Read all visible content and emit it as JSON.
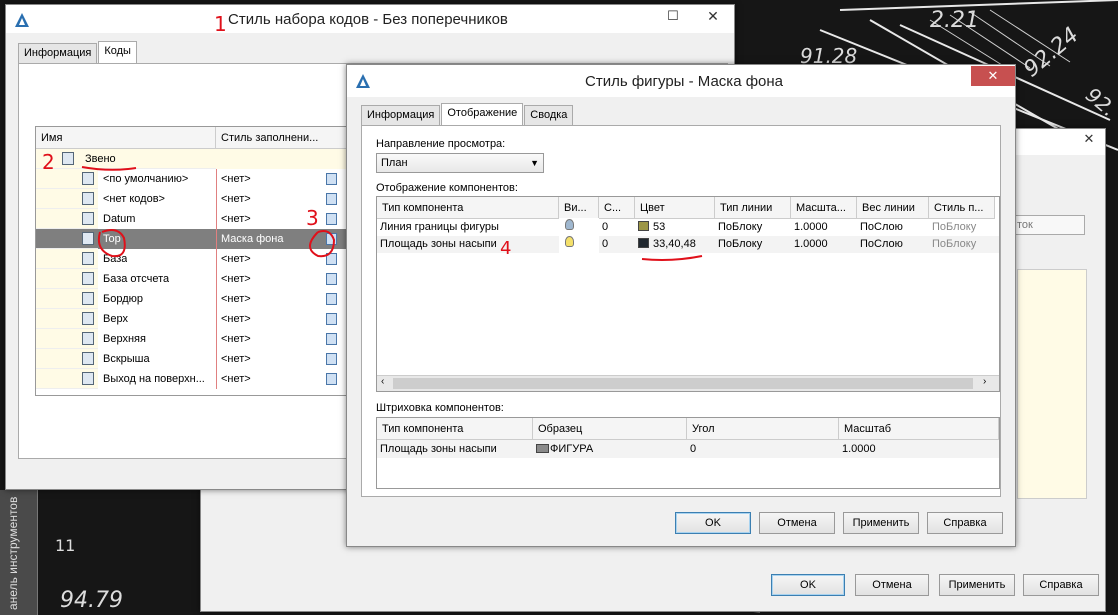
{
  "cad": {
    "labels": [
      "2.21",
      "91.28",
      "92.24",
      "92.",
      "94.79",
      "11"
    ],
    "toolstrip_label": "анель инструментов"
  },
  "backdialog": {
    "partial_text": "ток",
    "buttons": {
      "ok": "OK",
      "cancel": "Отмена",
      "apply": "Применить",
      "help": "Справка"
    }
  },
  "codeset": {
    "title": "Стиль набора кодов - Без поперечников",
    "tabs": [
      "Информация",
      "Коды"
    ],
    "columns": [
      "Имя",
      "Стиль заполнени..."
    ],
    "root": {
      "name": "Звено"
    },
    "rows": [
      {
        "name": "<по умолчанию>",
        "style": "<нет>"
      },
      {
        "name": "<нет кодов>",
        "style": "<нет>"
      },
      {
        "name": "Datum",
        "style": "<нет>"
      },
      {
        "name": "Top",
        "style": "Маска фона",
        "selected": true
      },
      {
        "name": "База",
        "style": "<нет>"
      },
      {
        "name": "База отсчета",
        "style": "<нет>"
      },
      {
        "name": "Бордюр",
        "style": "<нет>"
      },
      {
        "name": "Верх",
        "style": "<нет>"
      },
      {
        "name": "Верхняя",
        "style": "<нет>"
      },
      {
        "name": "Вскрыша",
        "style": "<нет>"
      },
      {
        "name": "Выход на поверхн...",
        "style": "<нет>"
      }
    ]
  },
  "shape": {
    "title": "Стиль фигуры - Маска фона",
    "tabs": [
      "Информация",
      "Отображение",
      "Сводка"
    ],
    "view_dir_label": "Направление просмотра:",
    "view_dir_value": "План",
    "comp_display_label": "Отображение компонентов:",
    "comp_columns": [
      "Тип компонента",
      "Ви...",
      "С...",
      "Цвет",
      "Тип линии",
      "Масшта...",
      "Вес линии",
      "Стиль п..."
    ],
    "comp_rows": [
      {
        "type": "Линия границы фигуры",
        "vis_icon": "bulb-off-icon",
        "c": "0",
        "color": "53",
        "color_hex": "#9c9646",
        "linetype": "ПоБлоку",
        "scale": "1.0000",
        "weight": "ПоСлою",
        "plot": "ПоБлоку"
      },
      {
        "type": "Площадь зоны насыпи",
        "vis_icon": "bulb-on-icon",
        "c": "0",
        "color": "33,40,48",
        "color_hex": "#21282f",
        "linetype": "ПоБлоку",
        "scale": "1.0000",
        "weight": "ПоСлою",
        "plot": "ПоБлоку"
      }
    ],
    "hatch_label": "Штриховка компонентов:",
    "hatch_columns": [
      "Тип компонента",
      "Образец",
      "Угол",
      "Масштаб"
    ],
    "hatch_rows": [
      {
        "type": "Площадь зоны насыпи",
        "pattern": "ФИГУРА",
        "angle": "0",
        "scale": "1.0000"
      }
    ],
    "buttons": {
      "ok": "OK",
      "cancel": "Отмена",
      "apply": "Применить",
      "help": "Справка"
    }
  },
  "annotations": [
    "1",
    "2",
    "3",
    "4"
  ]
}
